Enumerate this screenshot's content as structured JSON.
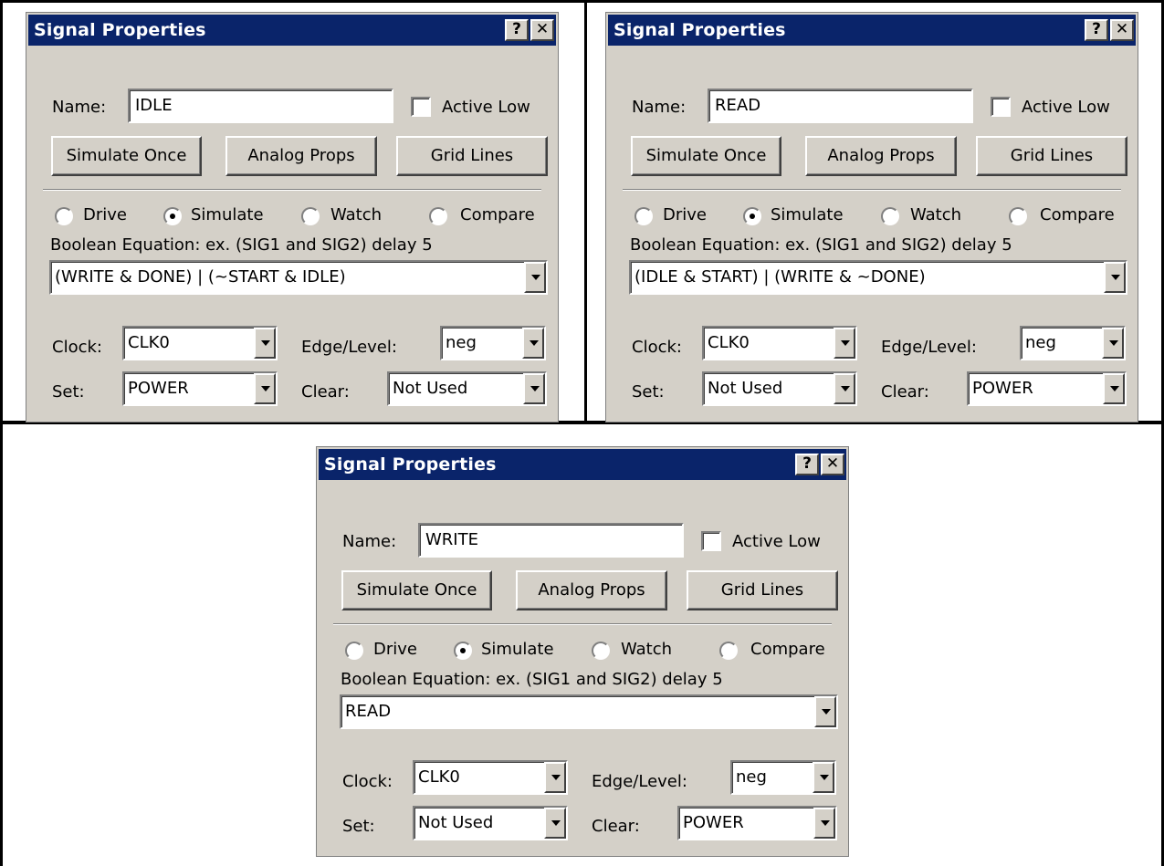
{
  "dialogs": [
    {
      "title": "Signal Properties",
      "help_button": "?",
      "close_button": "✕",
      "name_label": "Name:",
      "name_value": "IDLE",
      "active_low_label": "Active Low",
      "active_low_checked": false,
      "simulate_once": "Simulate Once",
      "analog_props": "Analog Props",
      "grid_lines": "Grid Lines",
      "radio_drive": "Drive",
      "radio_simulate": "Simulate",
      "radio_watch": "Watch",
      "radio_compare": "Compare",
      "selected_mode": "Simulate",
      "equation_label": "Boolean Equation: ex. (SIG1 and SIG2) delay 5",
      "equation_value": "(WRITE & DONE) | (~START & IDLE)",
      "clock_label": "Clock:",
      "clock_value": "CLK0",
      "edge_label": "Edge/Level:",
      "edge_value": "neg",
      "set_label": "Set:",
      "set_value": "POWER",
      "clear_label": "Clear:",
      "clear_value": "Not Used"
    },
    {
      "title": "Signal Properties",
      "help_button": "?",
      "close_button": "✕",
      "name_label": "Name:",
      "name_value": "READ",
      "active_low_label": "Active Low",
      "active_low_checked": false,
      "simulate_once": "Simulate Once",
      "analog_props": "Analog Props",
      "grid_lines": "Grid Lines",
      "radio_drive": "Drive",
      "radio_simulate": "Simulate",
      "radio_watch": "Watch",
      "radio_compare": "Compare",
      "selected_mode": "Simulate",
      "equation_label": "Boolean Equation: ex. (SIG1 and SIG2) delay 5",
      "equation_value": "(IDLE & START) | (WRITE & ~DONE)",
      "clock_label": "Clock:",
      "clock_value": "CLK0",
      "edge_label": "Edge/Level:",
      "edge_value": "neg",
      "set_label": "Set:",
      "set_value": "Not Used",
      "clear_label": "Clear:",
      "clear_value": "POWER"
    },
    {
      "title": "Signal Properties",
      "help_button": "?",
      "close_button": "✕",
      "name_label": "Name:",
      "name_value": "WRITE",
      "active_low_label": "Active Low",
      "active_low_checked": false,
      "simulate_once": "Simulate Once",
      "analog_props": "Analog Props",
      "grid_lines": "Grid Lines",
      "radio_drive": "Drive",
      "radio_simulate": "Simulate",
      "radio_watch": "Watch",
      "radio_compare": "Compare",
      "selected_mode": "Simulate",
      "equation_label": "Boolean Equation: ex. (SIG1 and SIG2) delay 5",
      "equation_value": "READ",
      "clock_label": "Clock:",
      "clock_value": "CLK0",
      "edge_label": "Edge/Level:",
      "edge_value": "neg",
      "set_label": "Set:",
      "set_value": "Not Used",
      "clear_label": "Clear:",
      "clear_value": "POWER"
    }
  ]
}
